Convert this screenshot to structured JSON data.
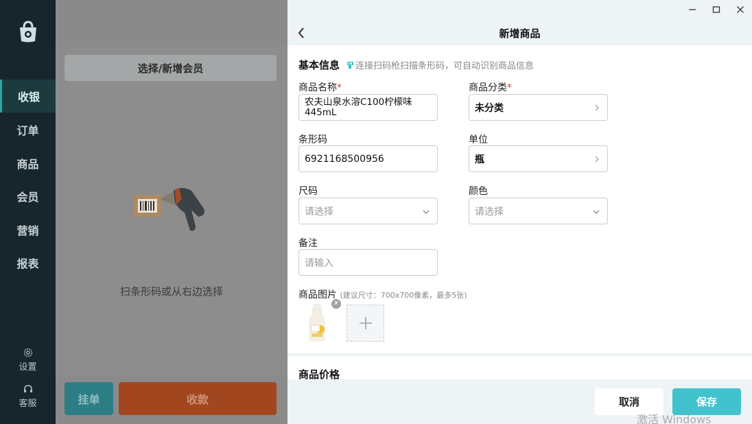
{
  "sidebar": {
    "items": [
      {
        "label": "收银",
        "active": true
      },
      {
        "label": "订单"
      },
      {
        "label": "商品"
      },
      {
        "label": "会员"
      },
      {
        "label": "营销"
      },
      {
        "label": "报表"
      }
    ],
    "settings_label": "设置",
    "service_label": "客服"
  },
  "middle": {
    "member_button": "选择/新增会员",
    "scan_hint": "扫条形码或从右边选择",
    "hold_button": "挂单",
    "pay_button": "收款"
  },
  "panel": {
    "title": "新增商品",
    "basic_section": "基本信息",
    "scan_hint": "连接扫码枪扫描条形码，可自动识别商品信息",
    "fields": {
      "name_label": "商品名称",
      "name_value": "农夫山泉水溶C100柠檬味445mL",
      "category_label": "商品分类",
      "category_value": "未分类",
      "barcode_label": "条形码",
      "barcode_value": "6921168500956",
      "unit_label": "单位",
      "unit_value": "瓶",
      "size_label": "尺码",
      "size_placeholder": "请选择",
      "color_label": "颜色",
      "color_placeholder": "请选择",
      "note_label": "备注",
      "note_placeholder": "请输入"
    },
    "image_label": "商品图片",
    "image_hint": "(建议尺寸：700x700像素，最多5张)",
    "price_section": "商品价格",
    "cancel_button": "取消",
    "save_button": "保存"
  },
  "watermark": "激活 Windows",
  "colors": {
    "accent": "#41c2cc",
    "sidebar_bg": "#17262d",
    "pay": "#a1461f",
    "required": "#e53935"
  }
}
